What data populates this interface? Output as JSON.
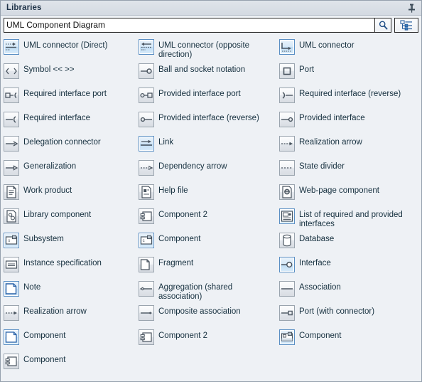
{
  "window": {
    "title": "Libraries",
    "pin_icon": "pin-icon"
  },
  "search": {
    "value": "UML Component Diagram",
    "placeholder": "",
    "search_icon": "search-icon",
    "tree_view_icon": "tree-view-icon",
    "tree_view_tooltip": "Tree view"
  },
  "colors": {
    "titlebar_bg": "#dfe4ea",
    "panel_bg": "#eef1f5",
    "selected_icon_border": "#5a8fc4",
    "selected_icon_bg": "#cfe5f7",
    "text": "#16303f",
    "accent": "#1a5a9e"
  },
  "columns": 3,
  "items": [
    {
      "label": "UML connector (Direct)",
      "icon": "uml-connector-direct-icon",
      "selected": true
    },
    {
      "label": "UML connector (opposite direction)",
      "icon": "uml-connector-opposite-icon",
      "selected": true
    },
    {
      "label": "UML connector",
      "icon": "uml-connector-icon",
      "selected": true
    },
    {
      "label": "Symbol << >>",
      "icon": "symbol-guillemets-icon",
      "selected": false
    },
    {
      "label": "Ball and socket notation",
      "icon": "ball-and-socket-icon",
      "selected": false
    },
    {
      "label": "Port",
      "icon": "port-icon",
      "selected": false
    },
    {
      "label": "Required interface port",
      "icon": "required-interface-port-icon",
      "selected": false
    },
    {
      "label": "Provided interface port",
      "icon": "provided-interface-port-icon",
      "selected": false
    },
    {
      "label": "Required interface (reverse)",
      "icon": "required-interface-reverse-icon",
      "selected": false
    },
    {
      "label": "Required interface",
      "icon": "required-interface-icon",
      "selected": false
    },
    {
      "label": "Provided interface (reverse)",
      "icon": "provided-interface-reverse-icon",
      "selected": false
    },
    {
      "label": "Provided interface",
      "icon": "provided-interface-icon",
      "selected": false
    },
    {
      "label": "Delegation connector",
      "icon": "delegation-connector-icon",
      "selected": false
    },
    {
      "label": "Link",
      "icon": "link-icon",
      "selected": true
    },
    {
      "label": "Realization arrow",
      "icon": "realization-arrow-icon",
      "selected": false
    },
    {
      "label": "Generalization",
      "icon": "generalization-icon",
      "selected": false
    },
    {
      "label": "Dependency arrow",
      "icon": "dependency-arrow-icon",
      "selected": false
    },
    {
      "label": "State divider",
      "icon": "state-divider-icon",
      "selected": false
    },
    {
      "label": "Work product",
      "icon": "work-product-icon",
      "selected": false
    },
    {
      "label": "Help file",
      "icon": "help-file-icon",
      "selected": false
    },
    {
      "label": "Web-page component",
      "icon": "web-page-component-icon",
      "selected": false
    },
    {
      "label": "Library component",
      "icon": "library-component-icon",
      "selected": false
    },
    {
      "label": "Component 2",
      "icon": "component-2-icon",
      "selected": false
    },
    {
      "label": "List of required and provided interfaces",
      "icon": "list-interfaces-icon",
      "selected": true
    },
    {
      "label": "Subsystem",
      "icon": "subsystem-icon",
      "selected": true
    },
    {
      "label": "Component",
      "icon": "component-icon",
      "selected": true
    },
    {
      "label": "Database",
      "icon": "database-icon",
      "selected": false
    },
    {
      "label": "Instance specification",
      "icon": "instance-specification-icon",
      "selected": false
    },
    {
      "label": "Fragment",
      "icon": "fragment-icon",
      "selected": false
    },
    {
      "label": "Interface",
      "icon": "interface-icon",
      "selected": true
    },
    {
      "label": "Note",
      "icon": "note-icon",
      "selected": true
    },
    {
      "label": "Aggregation (shared association)",
      "icon": "aggregation-shared-icon",
      "selected": false
    },
    {
      "label": "Association",
      "icon": "association-icon",
      "selected": false
    },
    {
      "label": "Realization arrow",
      "icon": "realization-arrow-icon",
      "selected": false
    },
    {
      "label": "Composite association",
      "icon": "composite-association-icon",
      "selected": false
    },
    {
      "label": "Port (with connector)",
      "icon": "port-with-connector-icon",
      "selected": false
    },
    {
      "label": "Component",
      "icon": "component-box-icon",
      "selected": true
    },
    {
      "label": "Component 2",
      "icon": "component-2-icon",
      "selected": false
    },
    {
      "label": "Component",
      "icon": "component-filled-icon",
      "selected": true
    },
    {
      "label": "Component",
      "icon": "component-2-icon",
      "selected": false
    }
  ]
}
